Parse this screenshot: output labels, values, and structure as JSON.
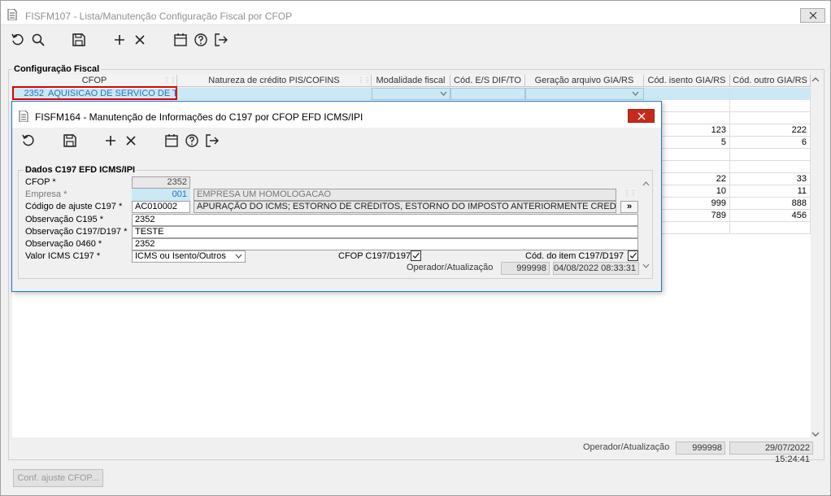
{
  "window": {
    "title": "FISFM107 - Lista/Manutenção Configuração Fiscal por CFOP",
    "close_icon": "close-icon"
  },
  "toolbar": {
    "icons": [
      "refresh-icon",
      "search-icon",
      "save-icon",
      "add-icon",
      "delete-icon",
      "calendar-icon",
      "help-icon",
      "exit-icon"
    ]
  },
  "group": {
    "label": "Configuração Fiscal"
  },
  "grid": {
    "columns": [
      "CFOP",
      "Natureza de crédito PIS/COFINS",
      "Modalidade fiscal",
      "Cód. E/S DIF/TO",
      "Geração arquivo GIA/RS",
      "Cód. isento GIA/RS",
      "Cód. outro GIA/RS"
    ],
    "selected_row": {
      "code": "2352",
      "description": "AQUISICAO DE SERVICO DE TRA"
    },
    "rows": [
      {
        "isento": "",
        "outro": ""
      },
      {
        "isento": "",
        "outro": ""
      },
      {
        "isento": "123",
        "outro": "222"
      },
      {
        "isento": "5",
        "outro": "6"
      },
      {
        "isento": "",
        "outro": ""
      },
      {
        "isento": "",
        "outro": ""
      },
      {
        "isento": "22",
        "outro": "33"
      },
      {
        "isento": "10",
        "outro": "11"
      },
      {
        "isento": "999",
        "outro": "888"
      },
      {
        "isento": "789",
        "outro": "456"
      },
      {
        "isento": "",
        "outro": ""
      }
    ]
  },
  "status": {
    "label": "Operador/Atualização",
    "operator": "999998",
    "timestamp": "29/07/2022 15:24:41"
  },
  "bottom_button": {
    "label": "Conf. ajuste CFOP..."
  },
  "dialog": {
    "title": "FISFM164 - Manutenção de Informações do C197 por CFOP EFD ICMS/IPI",
    "group_label": "Dados C197 EFD ICMS/IPI",
    "fields": {
      "cfop_label": "CFOP *",
      "cfop_value": "2352",
      "empresa_label": "Empresa *",
      "empresa_code": "001",
      "empresa_name": "EMPRESA UM HOMOLOGACAO",
      "ajuste_label": "Código de ajuste C197 *",
      "ajuste_code": "AC010002",
      "ajuste_desc": "APURAÇÃO DO ICMS; ESTORNO DE CRÉDITOS, ESTORNO DO IMPOSTO ANTERIORMENTE CREDITADO QU.",
      "ajuste_button": "»",
      "obs195_label": "Observação C195 *",
      "obs195_value": "2352",
      "obs197_label": "Observação C197/D197 *",
      "obs197_value": "TESTE",
      "obs460_label": "Observação 0460 *",
      "obs460_value": "2352",
      "valor_label": "Valor ICMS C197 *",
      "valor_value": "ICMS ou Isento/Outros",
      "cfop_c197_label": "CFOP C197/D197",
      "cfop_c197_checked": true,
      "cod_item_label": "Cód. do item C197/D197",
      "cod_item_checked": true,
      "operator_label": "Operador/Atualização",
      "operator_value": "999998",
      "timestamp_value": "04/08/2022 08:33:31"
    }
  }
}
